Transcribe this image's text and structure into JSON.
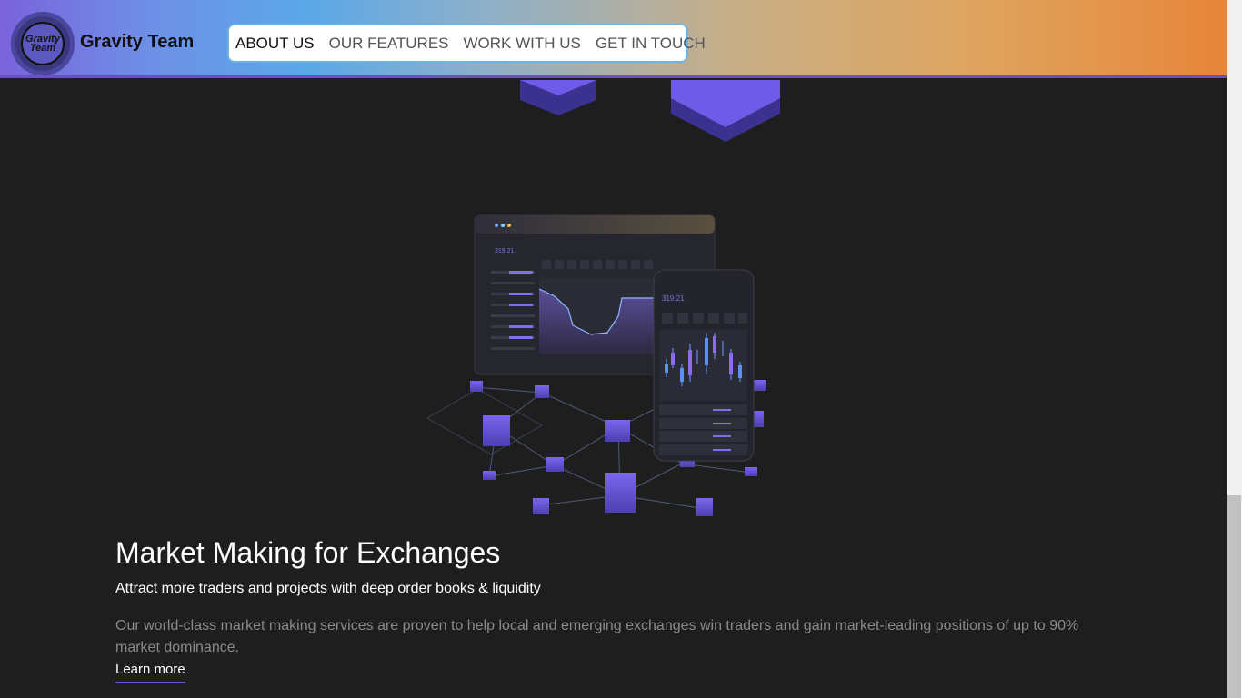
{
  "header": {
    "logo_text_line1": "Gravity",
    "logo_text_line2": "Team",
    "brand": "Gravity Team",
    "nav": [
      {
        "label": "ABOUT US",
        "active": true
      },
      {
        "label": "OUR FEATURES",
        "active": false
      },
      {
        "label": "WORK WITH US",
        "active": false
      },
      {
        "label": "GET IN TOUCH",
        "active": false
      }
    ]
  },
  "illustration": {
    "desktop_price": "319.21",
    "phone_price": "319.21"
  },
  "section": {
    "title": "Market Making for Exchanges",
    "subtitle": "Attract more traders and projects with deep order books & liquidity",
    "description": "Our world-class market making services are proven to help local and emerging exchanges win traders and gain market-leading positions of up to 90% market dominance.",
    "link": "Learn more"
  },
  "colors": {
    "accent": "#6c52d8",
    "background": "#1e1e1e"
  }
}
